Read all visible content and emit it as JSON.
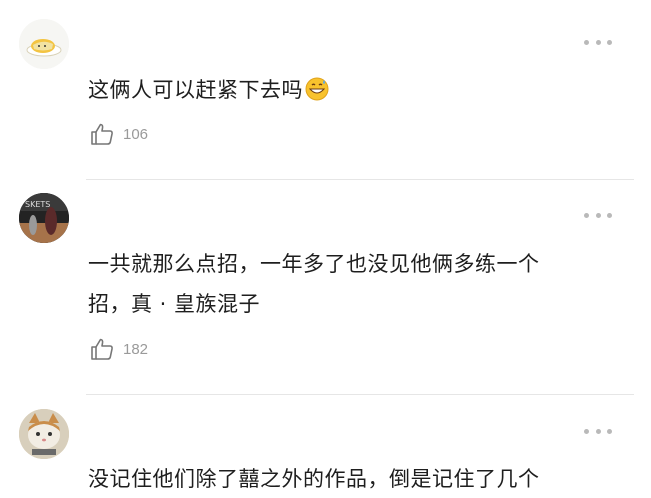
{
  "comments": [
    {
      "avatar": "gudetama-egg-avatar",
      "text": "这俩人可以赶紧下去吗",
      "emoji": "grinning-sweat-emoji",
      "likes": "106"
    },
    {
      "avatar": "basketball-stage-avatar",
      "text_line1": "一共就那么点招，一年多了也没见他俩多练一个",
      "text_line2": "招，真 · 皇族混子",
      "likes": "182"
    },
    {
      "avatar": "cat-avatar",
      "text": "没记住他们除了囍之外的作品，倒是记住了几个"
    }
  ],
  "icons": {
    "more": "more-icon",
    "like": "thumbs-up-icon"
  },
  "colors": {
    "text": "#1e1e1e",
    "meta": "#9a9a9a",
    "dots": "#b9b9b9",
    "divider": "#e6e6e6"
  }
}
